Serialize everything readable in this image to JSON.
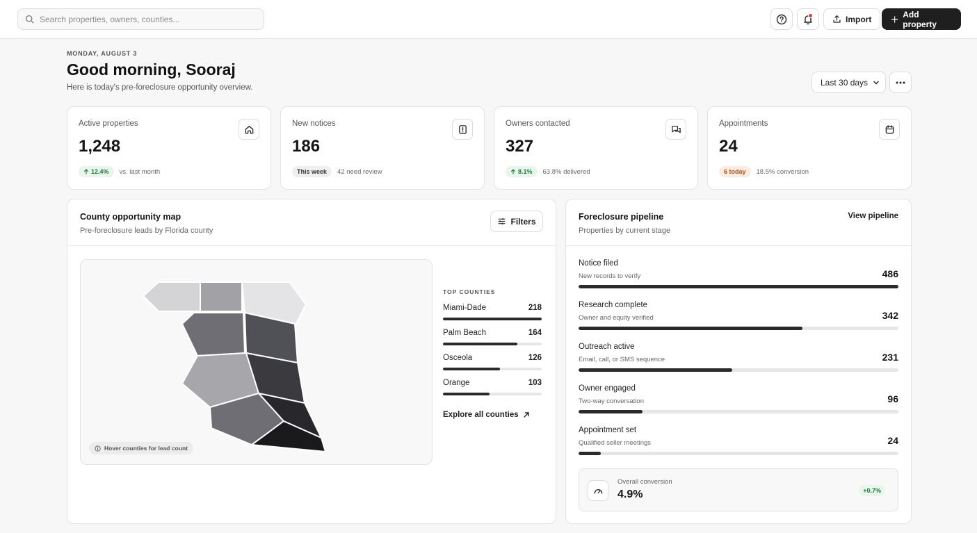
{
  "search": {
    "placeholder": "Search properties, owners, counties..."
  },
  "topbar": {
    "import_label": "Import",
    "add_label": "Add property"
  },
  "header": {
    "date": "MONDAY, AUGUST 3",
    "greeting": "Good morning, Sooraj",
    "subtitle": "Here is today's pre-foreclosure opportunity overview.",
    "range": "Last 30 days"
  },
  "stats": [
    {
      "label": "Active properties",
      "value": "1,248",
      "badge": "12.4%",
      "note": "vs. last month",
      "icon": "home-icon"
    },
    {
      "label": "New notices",
      "value": "186",
      "badge": "This week",
      "note": "42 need review",
      "icon": "alert-doc-icon"
    },
    {
      "label": "Owners contacted",
      "value": "327",
      "badge": "8.1%",
      "note": "63.8% delivered",
      "icon": "chat-icon"
    },
    {
      "label": "Appointments",
      "value": "24",
      "badge": "6 today",
      "note": "18.5% conversion",
      "icon": "calendar-icon"
    }
  ],
  "map_panel": {
    "title": "County opportunity map",
    "subtitle": "Pre-foreclosure leads by Florida county",
    "filters_label": "Filters",
    "hint": "Hover counties for lead count",
    "top_heading": "TOP COUNTIES",
    "counties": [
      {
        "name": "Miami-Dade",
        "value": "218",
        "share": 1.0
      },
      {
        "name": "Palm Beach",
        "value": "164",
        "share": 0.75
      },
      {
        "name": "Osceola",
        "value": "126",
        "share": 0.58
      },
      {
        "name": "Orange",
        "value": "103",
        "share": 0.47
      }
    ],
    "explore_label": "Explore all counties"
  },
  "pipeline": {
    "title": "Foreclosure pipeline",
    "subtitle": "Properties by current stage",
    "view_label": "View pipeline",
    "stages": [
      {
        "name": "Notice filed",
        "desc": "New records to verify",
        "value": "486",
        "share": 1.0
      },
      {
        "name": "Research complete",
        "desc": "Owner and equity verified",
        "value": "342",
        "share": 0.7
      },
      {
        "name": "Outreach active",
        "desc": "Email, call, or SMS sequence",
        "value": "231",
        "share": 0.48
      },
      {
        "name": "Owner engaged",
        "desc": "Two-way conversation",
        "value": "96",
        "share": 0.2
      },
      {
        "name": "Appointment set",
        "desc": "Qualified seller meetings",
        "value": "24",
        "share": 0.07
      }
    ],
    "conversion_label": "Overall conversion",
    "conversion_value": "4.9%",
    "conversion_delta": "+0.7%"
  }
}
